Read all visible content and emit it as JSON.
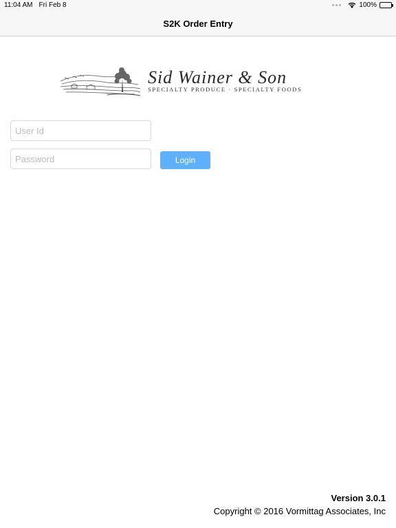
{
  "status_bar": {
    "time": "11:04 AM",
    "date": "Fri Feb 8",
    "battery": "100%",
    "wifi_icon": "wifi-icon",
    "battery_icon": "battery-icon"
  },
  "nav": {
    "title": "S2K Order Entry"
  },
  "logo": {
    "name": "Sid Wainer & Son",
    "tagline": "SPECIALTY PRODUCE · SPECIALTY FOODS"
  },
  "form": {
    "user_id": {
      "placeholder": "User Id",
      "value": ""
    },
    "password": {
      "placeholder": "Password",
      "value": ""
    },
    "login_label": "Login",
    "login_color": "#5fb0fa"
  },
  "footer": {
    "version": "Version 3.0.1",
    "copyright": "Copyright © 2016 Vormittag Associates, Inc"
  }
}
